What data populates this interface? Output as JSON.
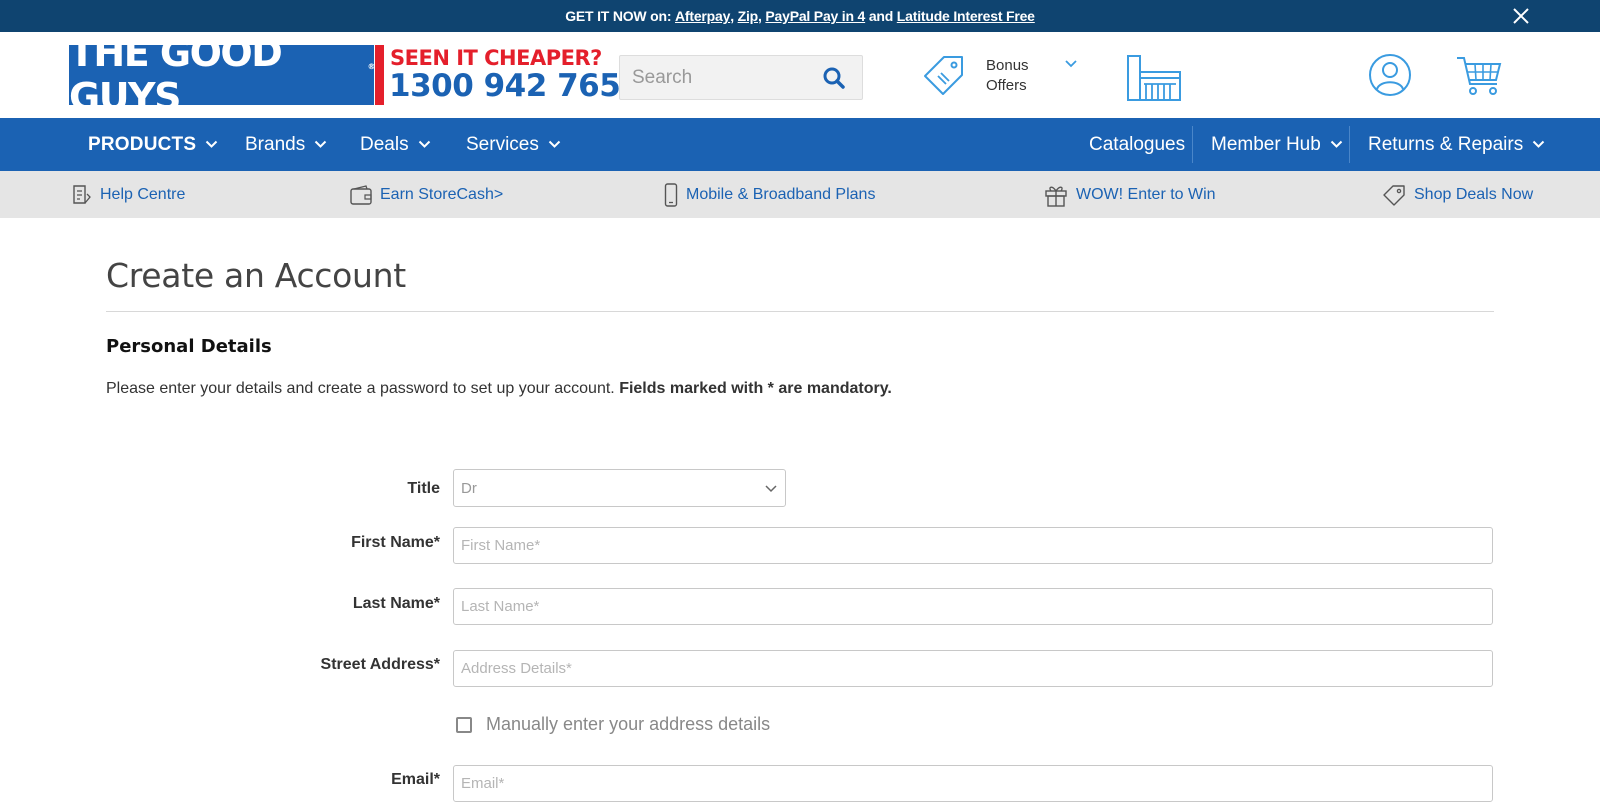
{
  "promo": {
    "prefix": "GET IT NOW on: ",
    "links": [
      "Afterpay",
      "Zip",
      "PayPal Pay in 4",
      "Latitude Interest Free"
    ],
    "comma": ", ",
    "and": " and "
  },
  "header": {
    "logo_text": "THE GOOD GUYS",
    "logo_mark": "®",
    "seen_text": "SEEN IT CHEAPER?",
    "phone": "1300 942 765",
    "search_placeholder": "Search",
    "bonus_line1": "Bonus",
    "bonus_line2": "Offers"
  },
  "nav": {
    "left": [
      "PRODUCTS",
      "Brands",
      "Deals",
      "Services"
    ],
    "right": [
      "Catalogues",
      "Member Hub",
      "Returns & Repairs"
    ]
  },
  "utility": [
    "Help Centre",
    "Earn StoreCash>",
    "Mobile & Broadband Plans",
    "WOW! Enter to Win",
    "Shop Deals Now"
  ],
  "main": {
    "title": "Create an Account",
    "section": "Personal Details",
    "intro": "Please enter your details and create a password to set up your account. ",
    "intro_bold": "Fields marked with * are mandatory.",
    "form": {
      "title_label": "Title",
      "title_value": "Dr",
      "first_label": "First Name*",
      "first_placeholder": "First Name*",
      "last_label": "Last Name*",
      "last_placeholder": "Last Name*",
      "street_label": "Street Address*",
      "street_placeholder": "Address Details*",
      "manual_label": "Manually enter your address details",
      "email_label": "Email*",
      "email_placeholder": "Email*"
    }
  },
  "colors": {
    "brand_blue": "#1b62b3",
    "promo_navy": "#0f4470",
    "brand_red": "#e41f2b",
    "icon_light_blue": "#3a9be0"
  }
}
